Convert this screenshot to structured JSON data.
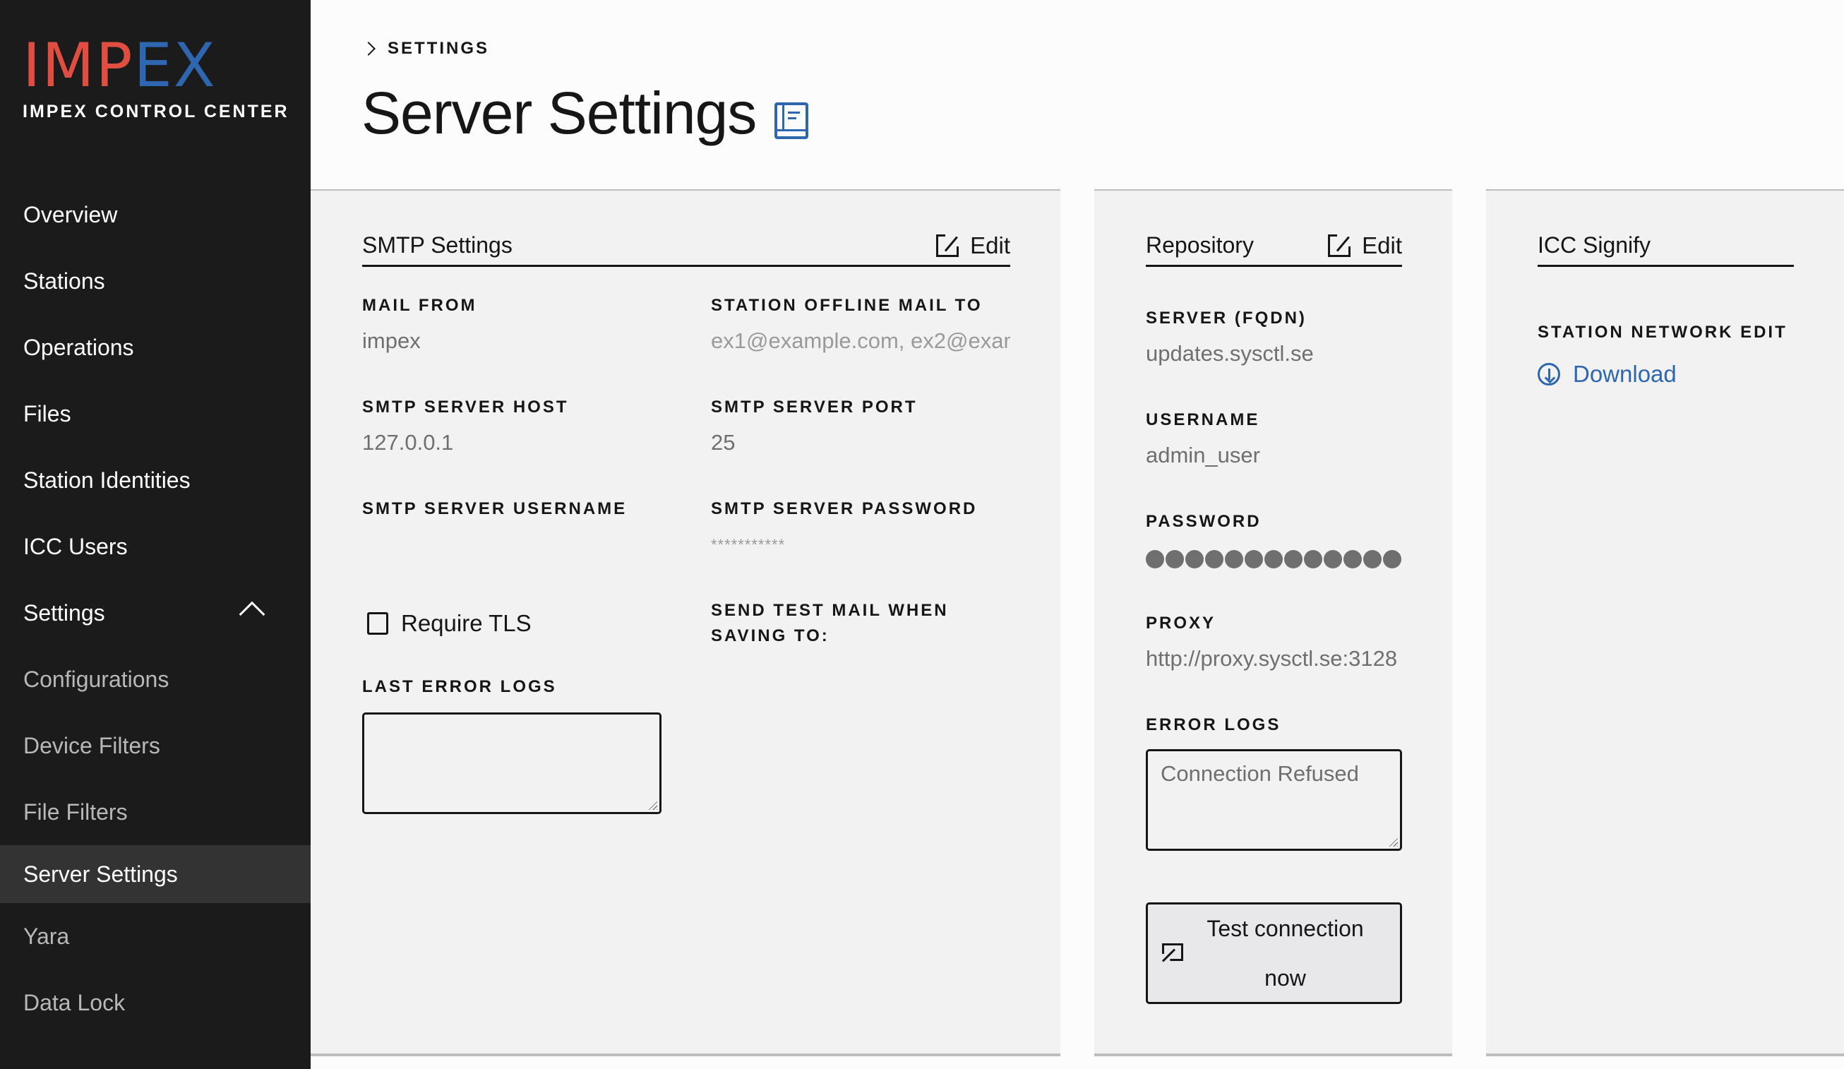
{
  "brand": {
    "logo_red": "IMP",
    "logo_blue": "EX",
    "subtitle": "IMPEX CONTROL CENTER",
    "colors": {
      "red": "#e04e42",
      "blue": "#2e66b0"
    }
  },
  "sidebar": {
    "items": [
      {
        "label": "Overview"
      },
      {
        "label": "Stations"
      },
      {
        "label": "Operations"
      },
      {
        "label": "Files"
      },
      {
        "label": "Station Identities"
      },
      {
        "label": "ICC Users"
      },
      {
        "label": "Settings",
        "expanded": true,
        "icon": "chevron-up-icon"
      },
      {
        "label": "Configurations"
      },
      {
        "label": "Device Filters"
      },
      {
        "label": "File Filters"
      },
      {
        "label": "Server Settings",
        "active": true
      },
      {
        "label": "Yara"
      },
      {
        "label": "Data Lock"
      }
    ]
  },
  "header": {
    "breadcrumb": "SETTINGS",
    "title": "Server Settings",
    "title_icon": "documentation-book-icon"
  },
  "smtp": {
    "title": "SMTP Settings",
    "edit_label": "Edit",
    "mail_from": {
      "label": "MAIL FROM",
      "value": "impex"
    },
    "station_offline_mail_to": {
      "label": "STATION OFFLINE MAIL TO",
      "value": "ex1@example.com, ex2@exam"
    },
    "host": {
      "label": "SMTP SERVER HOST",
      "value": "127.0.0.1"
    },
    "port": {
      "label": "SMTP SERVER PORT",
      "value": "25"
    },
    "username": {
      "label": "SMTP SERVER USERNAME",
      "value": ""
    },
    "password": {
      "label": "SMTP SERVER PASSWORD",
      "value": "***********"
    },
    "require_tls": {
      "label": "Require TLS",
      "checked": false
    },
    "send_test_mail": {
      "label": "SEND TEST MAIL WHEN SAVING TO:"
    },
    "last_error_logs": {
      "label": "LAST ERROR LOGS",
      "value": ""
    }
  },
  "repository": {
    "title": "Repository",
    "edit_label": "Edit",
    "server": {
      "label": "SERVER (FQDN)",
      "value": "updates.sysctl.se"
    },
    "username": {
      "label": "USERNAME",
      "value": "admin_user"
    },
    "password": {
      "label": "PASSWORD",
      "masked_length": 13
    },
    "proxy": {
      "label": "PROXY",
      "value": "http://proxy.sysctl.se:3128"
    },
    "error_logs": {
      "label": "ERROR LOGS",
      "value": "Connection Refused"
    },
    "test_button": "Test connection now"
  },
  "icc_signify": {
    "title": "ICC Signify",
    "station_network_edit": {
      "label": "STATION NETWORK EDIT"
    },
    "download_label": "Download"
  }
}
